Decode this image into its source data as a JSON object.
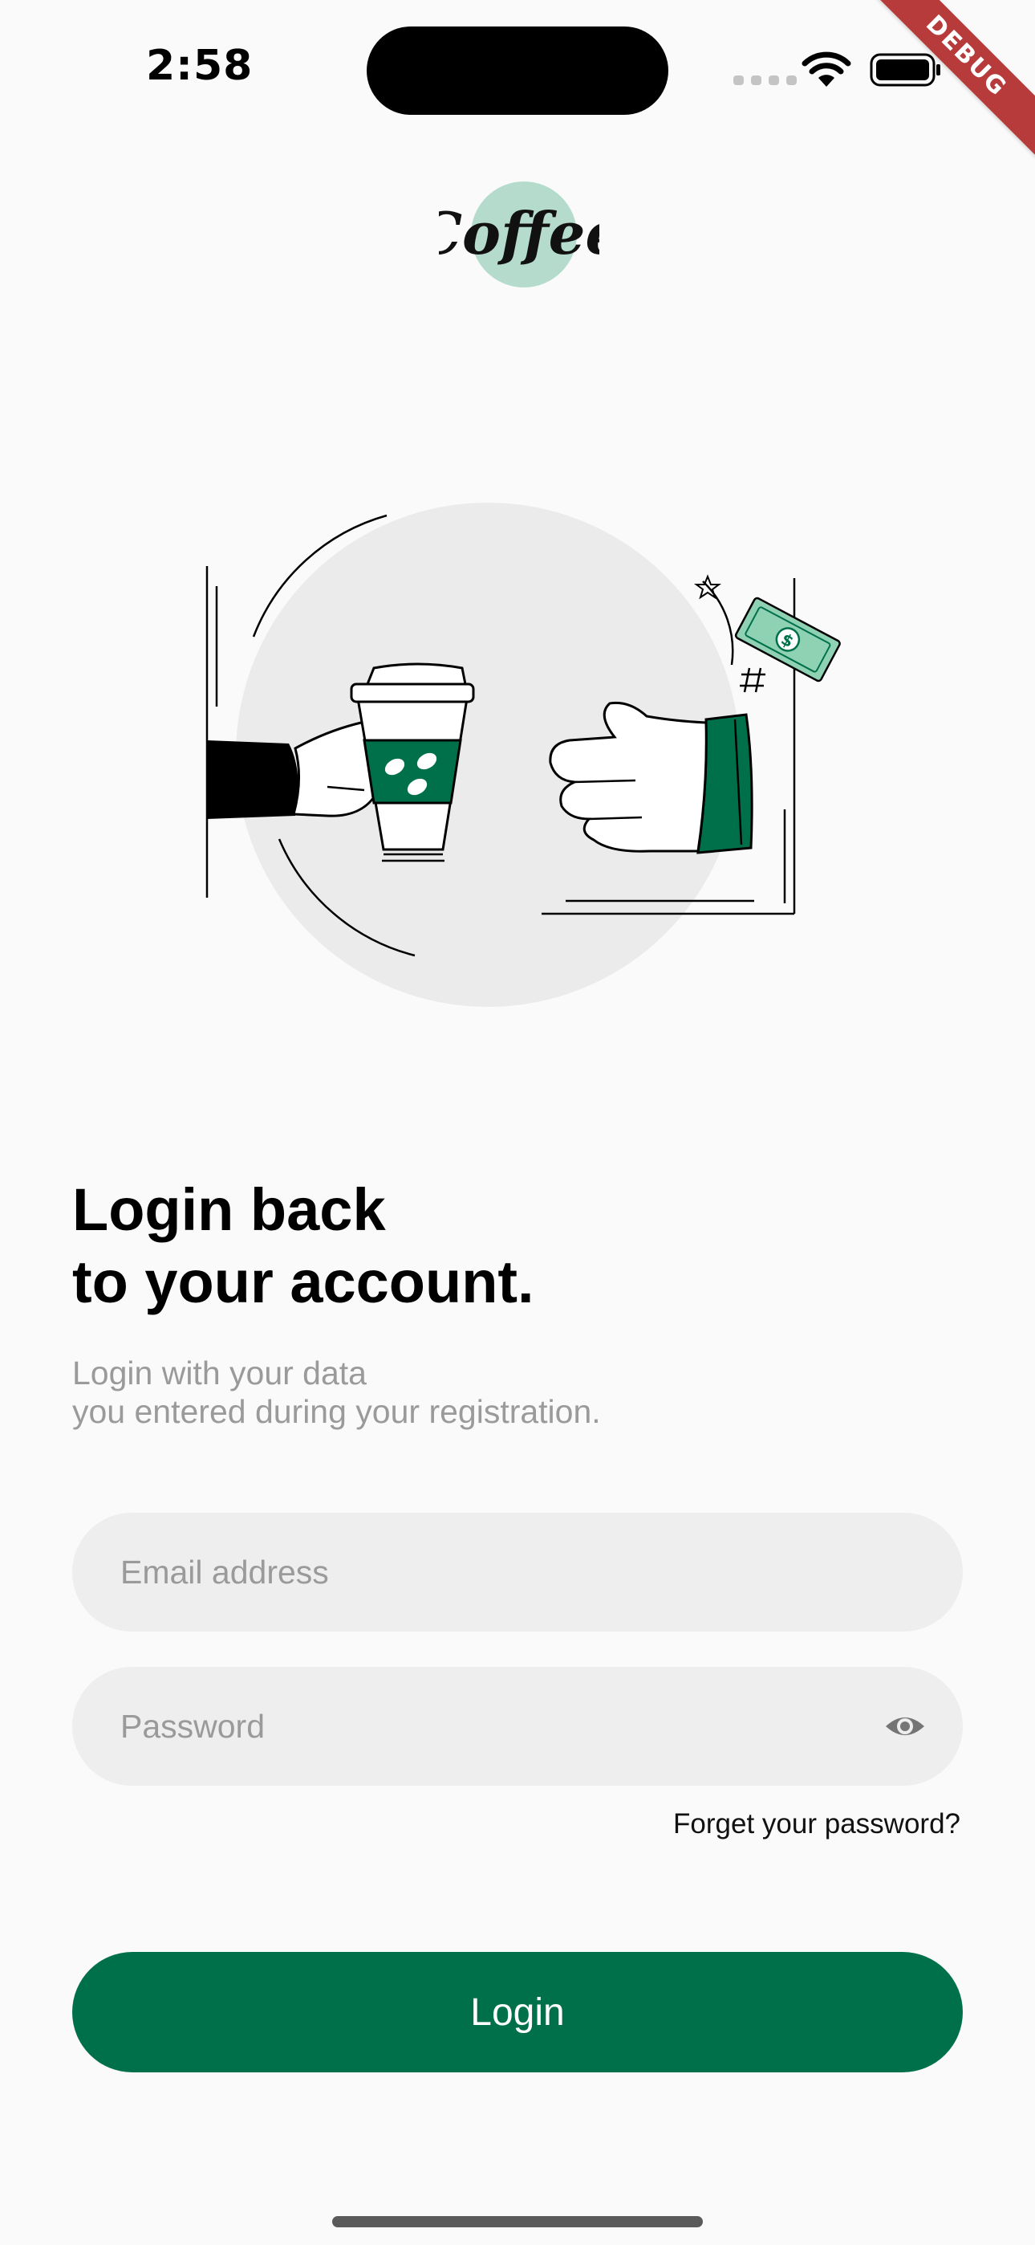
{
  "status_bar": {
    "time": "2:58"
  },
  "debug_banner": "DEBUG",
  "logo": {
    "text": "Coffee",
    "brand_color": "#a8d5c4"
  },
  "login": {
    "title_line1": "Login back",
    "title_line2": "to your account.",
    "subtitle_line1": "Login with your data",
    "subtitle_line2": "you entered during your registration.",
    "email_placeholder": "Email address",
    "password_placeholder": "Password",
    "forgot_password": "Forget your password?",
    "login_button": "Login"
  },
  "colors": {
    "accent": "#00704a",
    "input_background": "#eeeeee",
    "page_background": "#fafafa",
    "debug_ribbon": "#b83b3b"
  },
  "icons": {
    "wifi": "wifi-icon",
    "battery": "battery-icon",
    "password_visibility": "eye-icon",
    "illustration": "coffee-exchange-illustration"
  }
}
